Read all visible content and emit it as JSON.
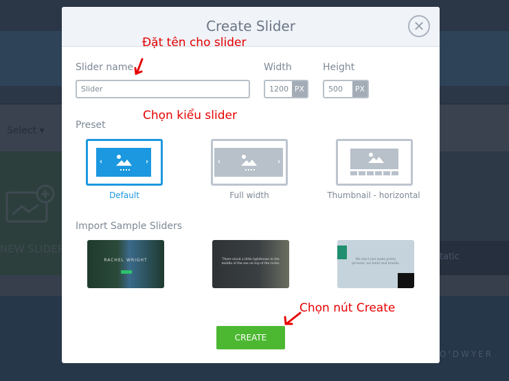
{
  "background": {
    "select_label": "Select",
    "new_slider_label": "NEW SLIDER",
    "static_label": "tatic",
    "card_name": "O'DWYER"
  },
  "modal": {
    "title": "Create Slider",
    "slider_name_label": "Slider name",
    "slider_name_value": "Slider",
    "width_label": "Width",
    "width_value": "1200",
    "width_unit": "PX",
    "height_label": "Height",
    "height_value": "500",
    "height_unit": "PX",
    "preset_label": "Preset",
    "presets": [
      {
        "label": "Default",
        "selected": true
      },
      {
        "label": "Full width",
        "selected": false
      },
      {
        "label": "Thumbnail - horizontal",
        "selected": false
      }
    ],
    "import_label": "Import Sample Sliders",
    "samples": [
      {
        "text": "RACHEL WRIGHT"
      },
      {
        "text": "There stood a little lighthouse in the middle of the sea on top of the rocks."
      },
      {
        "text": "We don't just make pretty pictures, we build real brands."
      }
    ],
    "create_label": "CREATE",
    "accent": "#1b98e0",
    "create_color": "#4cb832"
  },
  "annotations": {
    "name": "Đặt tên cho slider",
    "preset": "Chọn kiểu slider",
    "create": "Chọn nút Create",
    "color": "#e60000"
  }
}
